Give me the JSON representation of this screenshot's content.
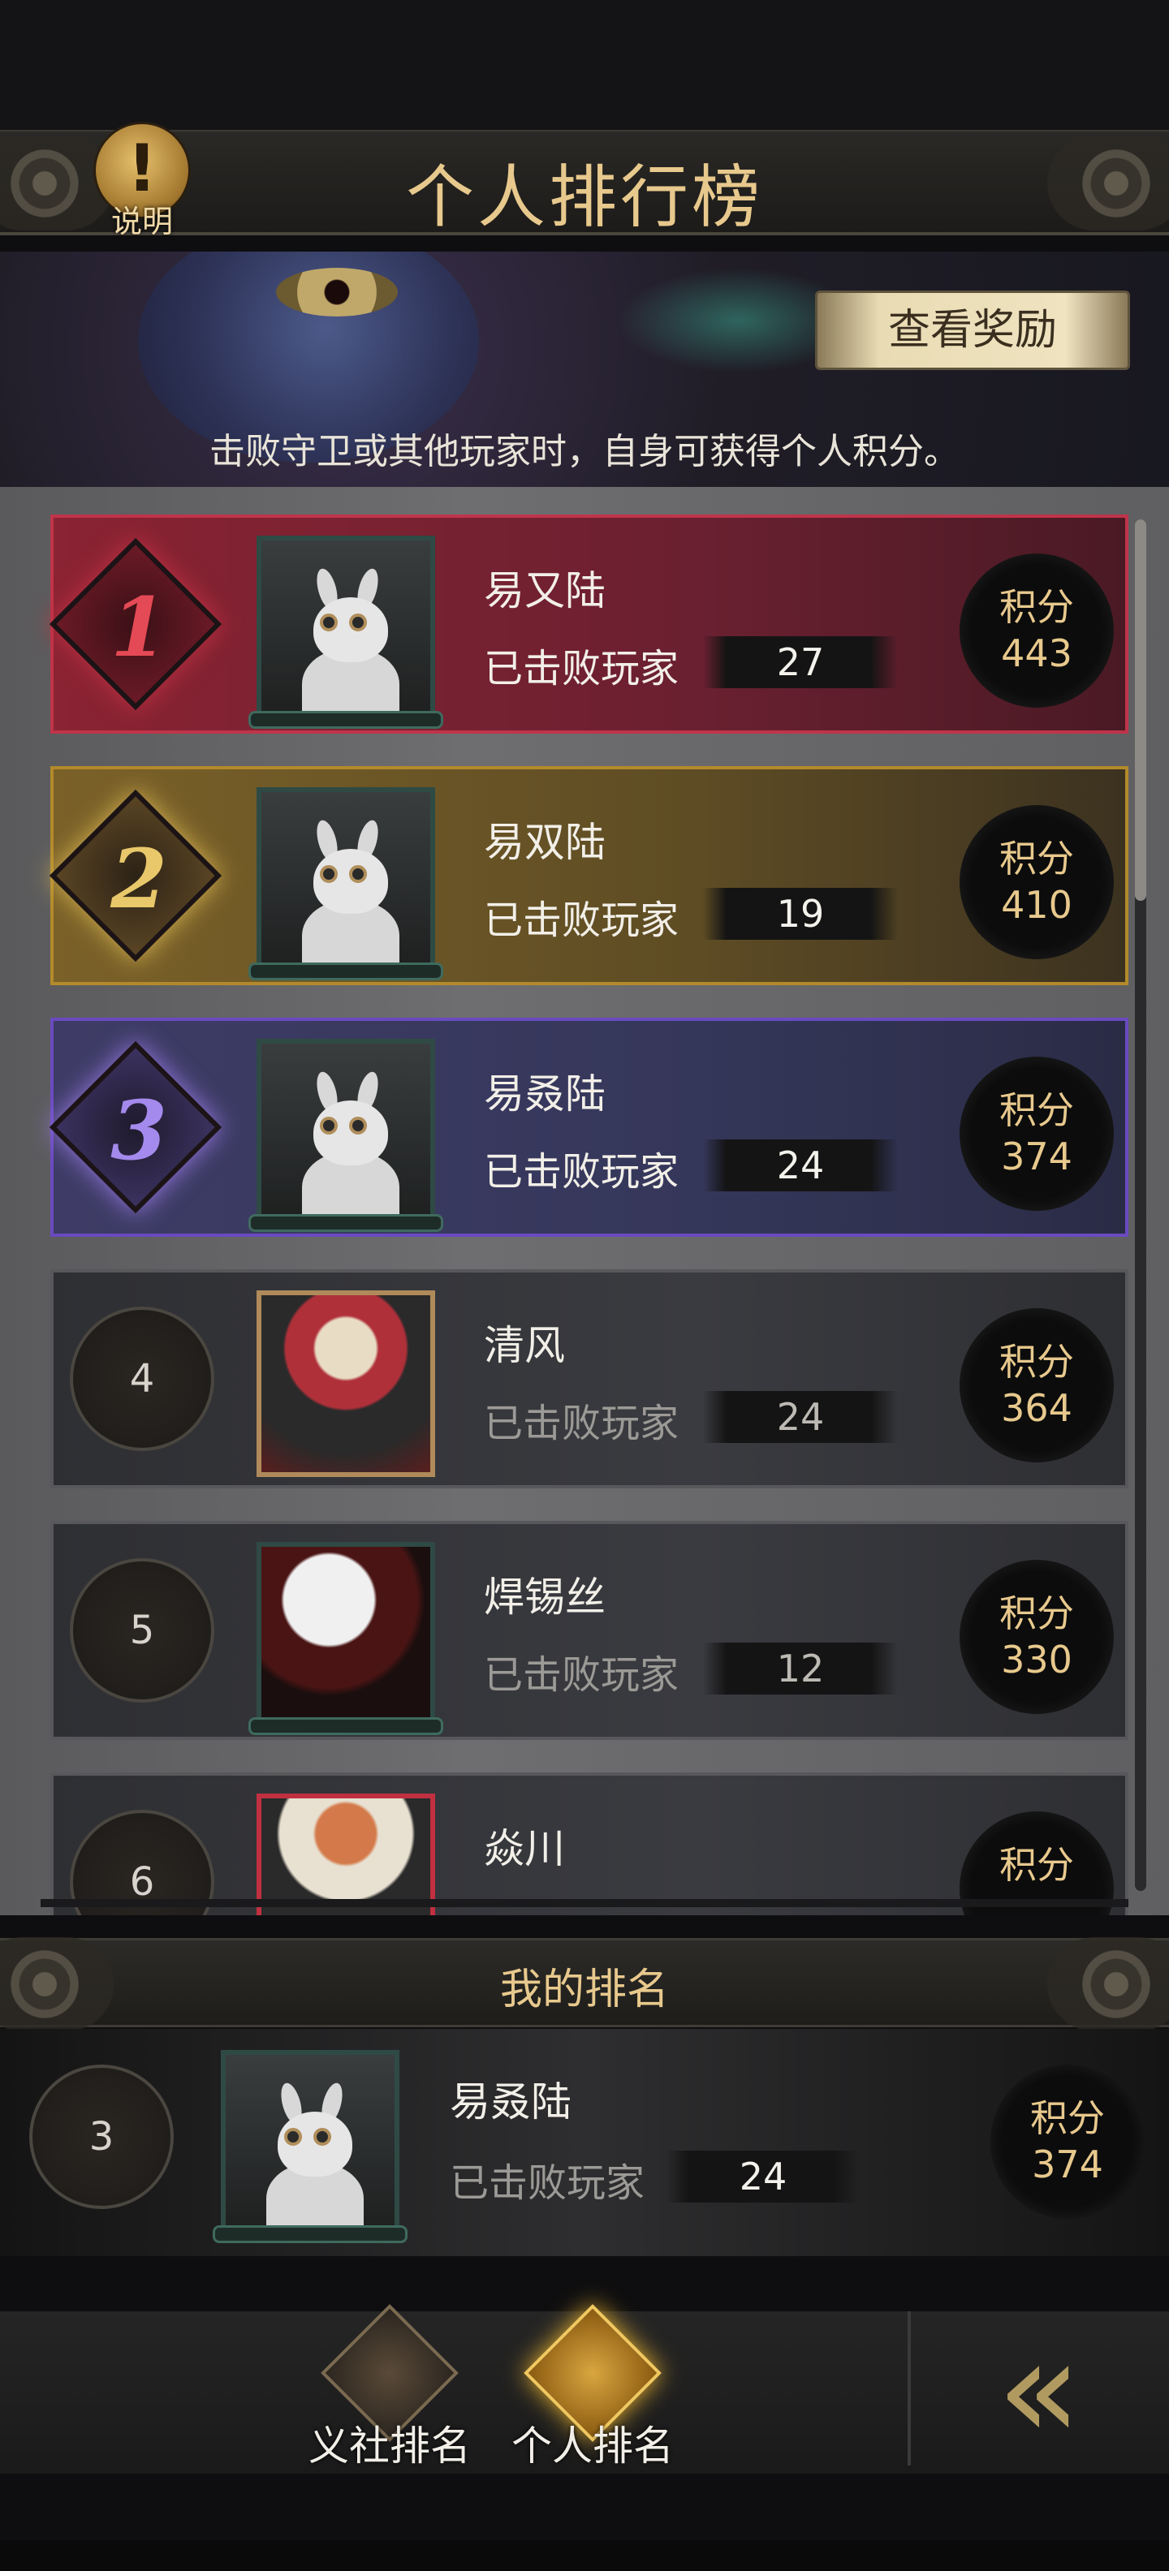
{
  "header": {
    "title": "个人排行榜",
    "help_label": "说明",
    "help_icon": "!"
  },
  "banner": {
    "reward_button": "查看奖励",
    "note": "击败守卫或其他玩家时，自身可获得个人积分。"
  },
  "leaderboard": [
    {
      "rank": "1",
      "name": "易又陆",
      "sub_label": "已击败玩家",
      "defeated": "27",
      "score_label": "积分",
      "score": "443"
    },
    {
      "rank": "2",
      "name": "易双陆",
      "sub_label": "已击败玩家",
      "defeated": "19",
      "score_label": "积分",
      "score": "410"
    },
    {
      "rank": "3",
      "name": "易叒陆",
      "sub_label": "已击败玩家",
      "defeated": "24",
      "score_label": "积分",
      "score": "374"
    },
    {
      "rank": "4",
      "name": "清风",
      "sub_label": "已击败玩家",
      "defeated": "24",
      "score_label": "积分",
      "score": "364"
    },
    {
      "rank": "5",
      "name": "焊锡丝",
      "sub_label": "已击败玩家",
      "defeated": "12",
      "score_label": "积分",
      "score": "330"
    },
    {
      "rank": "6",
      "name": "焱川",
      "score_label": "积分"
    }
  ],
  "my_rank": {
    "title": "我的排名",
    "rank": "3",
    "name": "易叒陆",
    "sub_label": "已击败玩家",
    "defeated": "24",
    "score_label": "积分",
    "score": "374"
  },
  "bottom_nav": {
    "tabs": [
      {
        "label": "义社排名",
        "icon": "guild-emblem-icon",
        "active": false
      },
      {
        "label": "个人排名",
        "icon": "scroll-emblem-icon",
        "active": true
      }
    ],
    "back_icon": "double-chevron-left-icon"
  },
  "colors": {
    "gold_text": "#e8c98d",
    "rank1": "#c0344a",
    "rank2": "#b38a2b",
    "rank3": "#6a4ac0"
  }
}
